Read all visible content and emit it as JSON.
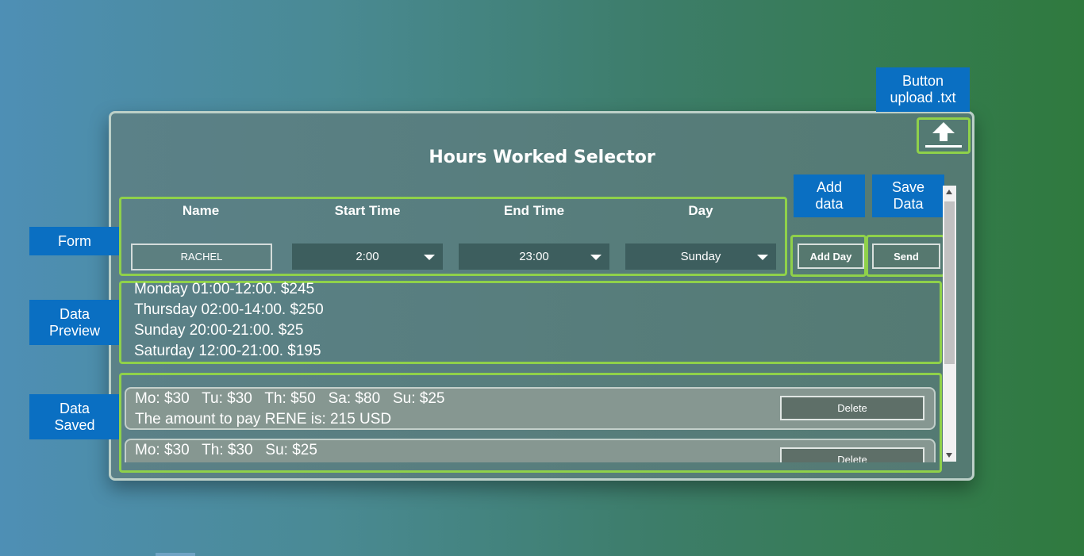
{
  "app": {
    "title": "Hours Worked Selector"
  },
  "callouts": {
    "upload": "Button upload .txt",
    "add_data": "Add data",
    "save_data": "Save Data",
    "form": "Form",
    "data_preview": "Data Preview",
    "data_saved": "Data Saved"
  },
  "form": {
    "name_label": "Name",
    "start_label": "Start Time",
    "end_label": "End Time",
    "day_label": "Day",
    "name_value": "RACHEL",
    "start_value": "2:00",
    "end_value": "23:00",
    "day_value": "Sunday",
    "add_day_label": "Add Day",
    "send_label": "Send"
  },
  "preview": {
    "lines": [
      "Monday 01:00-12:00. $245",
      "Thursday 02:00-14:00. $250",
      "Sunday 20:00-21:00. $25",
      "Saturday 12:00-21:00. $195"
    ]
  },
  "saved": [
    {
      "breakdown": "Mo: $30   Tu: $30   Th: $50   Sa: $80   Su: $25",
      "total": "The amount to pay RENE is: 215 USD",
      "delete_label": "Delete"
    },
    {
      "breakdown": "Mo: $30   Th: $30   Su: $25",
      "delete_label": "Delete"
    }
  ],
  "colors": {
    "highlight": "#8fd14a",
    "callout": "#0a6fc2"
  },
  "icons": {
    "upload": "upload-icon",
    "dropdown": "chevron-down-icon"
  }
}
